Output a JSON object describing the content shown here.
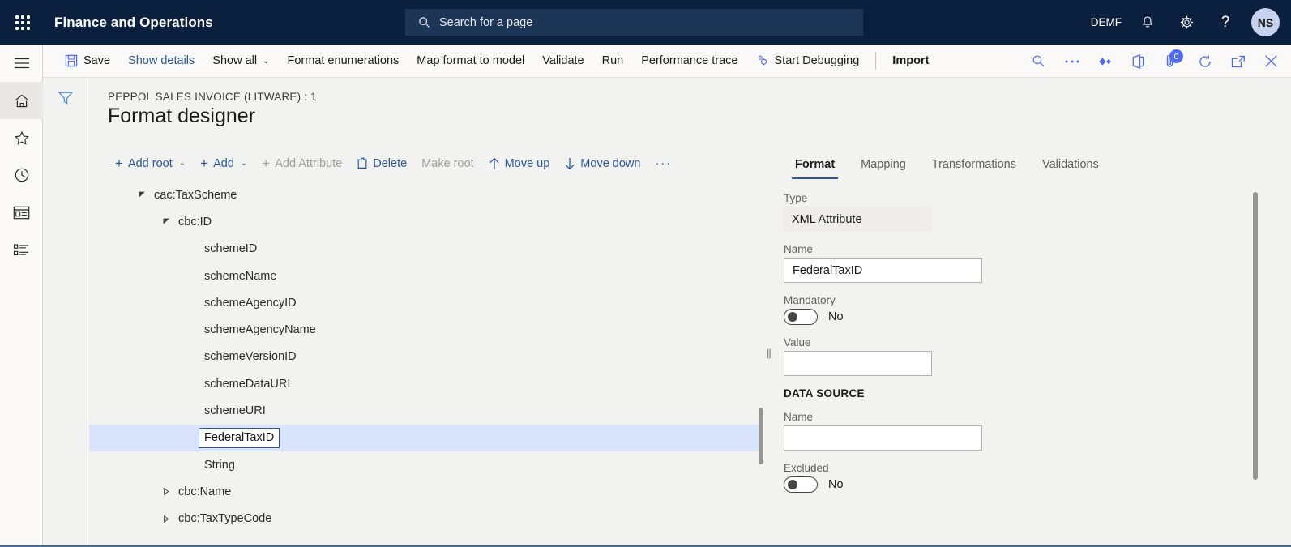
{
  "topbar": {
    "waffle_icon": "app-launcher-icon",
    "app_title": "Finance and Operations",
    "search_placeholder": "Search for a page",
    "search_icon": "search-icon",
    "company": "DEMF",
    "notification_icon": "bell-icon",
    "settings_icon": "gear-icon",
    "help_icon": "question-mark-icon",
    "avatar_initials": "NS"
  },
  "rail": {
    "items": [
      {
        "name": "hamburger-menu",
        "icon": "hamburger-icon"
      },
      {
        "name": "home",
        "icon": "home-icon"
      },
      {
        "name": "favorites",
        "icon": "star-icon"
      },
      {
        "name": "recent",
        "icon": "clock-icon"
      },
      {
        "name": "workspaces",
        "icon": "workspace-icon"
      },
      {
        "name": "modules",
        "icon": "list-icon"
      }
    ]
  },
  "commandbar": {
    "save_label": "Save",
    "save_icon": "save-disk-icon",
    "show_details_label": "Show details",
    "show_all_label": "Show all",
    "format_enumerations_label": "Format enumerations",
    "map_format_to_model_label": "Map format to model",
    "validate_label": "Validate",
    "run_label": "Run",
    "performance_trace_label": "Performance trace",
    "start_debugging_label": "Start Debugging",
    "start_debugging_icon": "debug-gear-icon",
    "import_label": "Import",
    "search_icon": "search-icon",
    "overflow_icon": "ellipsis-icon",
    "relations_icon": "diamond-relations-icon",
    "office_icon": "office-open-icon",
    "attachments_icon": "attachment-icon",
    "attachments_count": "0",
    "refresh_icon": "refresh-icon",
    "popout_icon": "open-in-new-window-icon",
    "close_icon": "close-x-icon"
  },
  "page": {
    "filter_icon": "filter-funnel-icon",
    "breadcrumb": "PEPPOL SALES INVOICE (LITWARE) : 1",
    "title": "Format designer"
  },
  "designer_toolbar": {
    "add_root_label": "Add root",
    "add_label": "Add",
    "add_attribute_label": "Add Attribute",
    "delete_label": "Delete",
    "delete_icon": "trash-icon",
    "make_root_label": "Make root",
    "move_up_label": "Move up",
    "move_up_icon": "arrow-up-icon",
    "move_down_label": "Move down",
    "move_down_icon": "arrow-down-icon",
    "overflow_label": "···"
  },
  "tree": {
    "rows": [
      {
        "label": "cac:TaxScheme",
        "indent": 78,
        "twisty": "expanded",
        "selected": false,
        "boxed": false
      },
      {
        "label": "cbc:ID",
        "indent": 108,
        "twisty": "expanded",
        "selected": false,
        "boxed": false
      },
      {
        "label": "schemeID",
        "indent": 140,
        "twisty": "none",
        "selected": false,
        "boxed": false
      },
      {
        "label": "schemeName",
        "indent": 140,
        "twisty": "none",
        "selected": false,
        "boxed": false
      },
      {
        "label": "schemeAgencyID",
        "indent": 140,
        "twisty": "none",
        "selected": false,
        "boxed": false
      },
      {
        "label": "schemeAgencyName",
        "indent": 140,
        "twisty": "none",
        "selected": false,
        "boxed": false
      },
      {
        "label": "schemeVersionID",
        "indent": 140,
        "twisty": "none",
        "selected": false,
        "boxed": false
      },
      {
        "label": "schemeDataURI",
        "indent": 140,
        "twisty": "none",
        "selected": false,
        "boxed": false
      },
      {
        "label": "schemeURI",
        "indent": 140,
        "twisty": "none",
        "selected": false,
        "boxed": false
      },
      {
        "label": "FederalTaxID",
        "indent": 140,
        "twisty": "none",
        "selected": true,
        "boxed": true
      },
      {
        "label": "String",
        "indent": 140,
        "twisty": "none",
        "selected": false,
        "boxed": false
      },
      {
        "label": "cbc:Name",
        "indent": 108,
        "twisty": "collapsed",
        "selected": false,
        "boxed": false
      },
      {
        "label": "cbc:TaxTypeCode",
        "indent": 108,
        "twisty": "collapsed",
        "selected": false,
        "boxed": false
      }
    ]
  },
  "rightpanel": {
    "tabs": [
      {
        "label": "Format",
        "active": true
      },
      {
        "label": "Mapping",
        "active": false
      },
      {
        "label": "Transformations",
        "active": false
      },
      {
        "label": "Validations",
        "active": false
      }
    ],
    "type_label": "Type",
    "type_value": "XML Attribute",
    "name_label": "Name",
    "name_value": "FederalTaxID",
    "mandatory_label": "Mandatory",
    "mandatory_value": "No",
    "value_label": "Value",
    "value_value": "",
    "data_source_section": "DATA SOURCE",
    "ds_name_label": "Name",
    "ds_name_value": "",
    "excluded_label": "Excluded",
    "excluded_value": "No"
  },
  "colors": {
    "header_navy": "#0b1f3f",
    "accent_blue": "#2b579a",
    "selection_blue": "#d9e4fb",
    "page_bg": "#f2f2f1",
    "badge_blue": "#4f6bed"
  }
}
